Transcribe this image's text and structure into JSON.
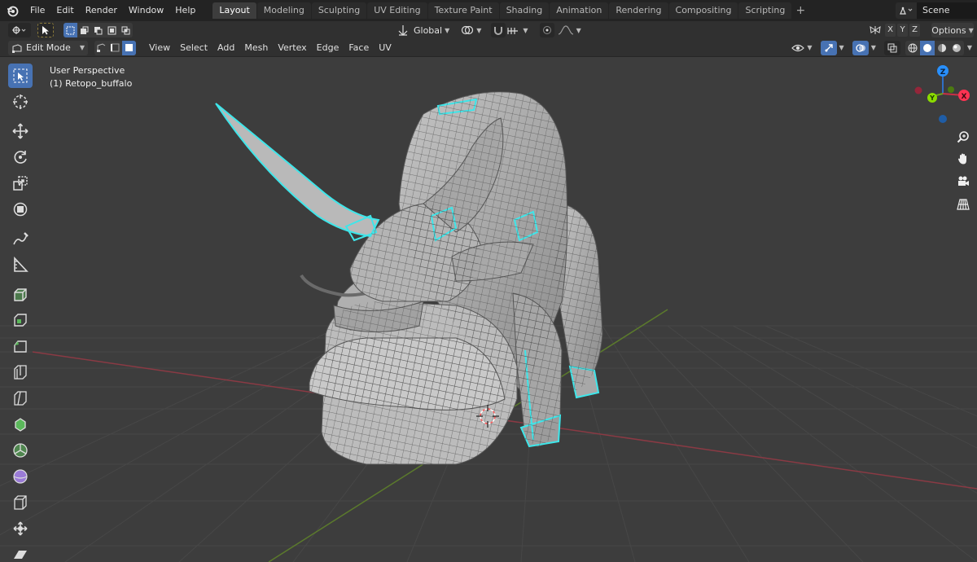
{
  "topbar": {
    "menus": [
      "File",
      "Edit",
      "Render",
      "Window",
      "Help"
    ],
    "workspaces": [
      "Layout",
      "Modeling",
      "Sculpting",
      "UV Editing",
      "Texture Paint",
      "Shading",
      "Animation",
      "Rendering",
      "Compositing",
      "Scripting"
    ],
    "active_workspace": "Layout",
    "add_workspace": "+",
    "scene_name": "Scene"
  },
  "header1": {
    "orientation": "Global",
    "axes": [
      "X",
      "Y",
      "Z"
    ],
    "options_label": "Options"
  },
  "header2": {
    "mode": "Edit Mode",
    "menus": [
      "View",
      "Select",
      "Add",
      "Mesh",
      "Vertex",
      "Edge",
      "Face",
      "UV"
    ]
  },
  "viewport": {
    "perspective_label": "User Perspective",
    "object_label": "(1) Retopo_buffalo"
  },
  "toolbar": {
    "tools": [
      "select-box",
      "cursor",
      "move",
      "rotate",
      "scale",
      "transform",
      "annotate",
      "measure",
      "extrude-region",
      "inset-faces",
      "bevel",
      "loop-cut",
      "knife",
      "poly-build",
      "spin",
      "smooth",
      "edge-slide",
      "shrink-fatten",
      "shear"
    ]
  },
  "gizmo": {
    "axes": [
      "Z",
      "X",
      "Y"
    ]
  },
  "colors": {
    "accent_blue": "#4772b3",
    "viewport_bg": "#3d3d3d",
    "x_axis": "#ff3352",
    "y_axis": "#8bdc00",
    "z_axis": "#2890ff",
    "retopo_highlight": "#3ee6ea"
  }
}
